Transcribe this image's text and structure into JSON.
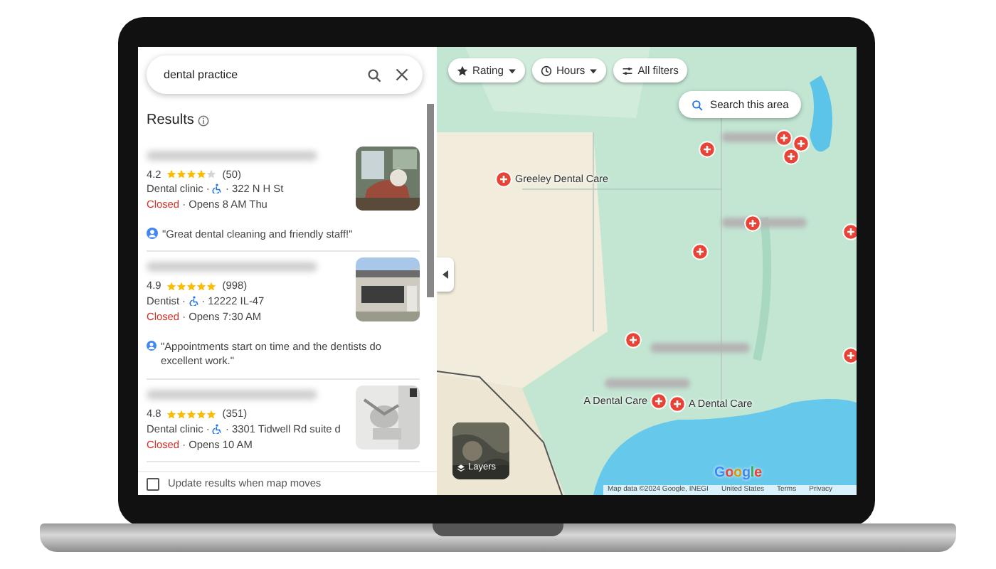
{
  "search": {
    "value": "dental practice"
  },
  "results_heading": "Results",
  "results": [
    {
      "rating": "4.2",
      "stars": 4,
      "reviews": "(50)",
      "category": "Dental clinic ·",
      "address": "· 322 N H St",
      "status": "Closed",
      "hours": "· Opens 8 AM Thu",
      "review": "\"Great dental cleaning and friendly staff!\""
    },
    {
      "rating": "4.9",
      "stars": 5,
      "reviews": "(998)",
      "category": "Dentist ·",
      "address": "· 12222 IL-47",
      "status": "Closed",
      "hours": "· Opens 7:30 AM",
      "review": "\"Appointments start on time and the dentists do excellent work.\""
    },
    {
      "rating": "4.8",
      "stars": 5,
      "reviews": "(351)",
      "category": "Dental clinic ·",
      "address": "· 3301 Tidwell Rd suite d",
      "status": "Closed",
      "hours": "· Opens 10 AM"
    }
  ],
  "update_checkbox": {
    "label": "Update results when map moves",
    "checked": false
  },
  "filters": [
    {
      "kind": "rating",
      "label": "Rating"
    },
    {
      "kind": "hours",
      "label": "Hours"
    },
    {
      "kind": "all",
      "label": "All filters"
    }
  ],
  "search_area_button": "Search this area",
  "pins": [
    {
      "kind": "labeled",
      "label": "Greeley Dental Care"
    },
    {
      "kind": "plain"
    },
    {
      "kind": "plain"
    },
    {
      "kind": "plain"
    },
    {
      "kind": "plain"
    },
    {
      "kind": "plain"
    },
    {
      "kind": "plain"
    },
    {
      "kind": "plain"
    },
    {
      "kind": "plain"
    },
    {
      "kind": "plain"
    },
    {
      "kind": "labeled",
      "label": "A Dental Care"
    },
    {
      "kind": "labeled",
      "label": "A Dental Care"
    }
  ],
  "layers_button": "Layers",
  "logo": "Google",
  "attribution": [
    "Map data ©2024 Google, INEGI",
    "United States",
    "Terms",
    "Privacy"
  ]
}
